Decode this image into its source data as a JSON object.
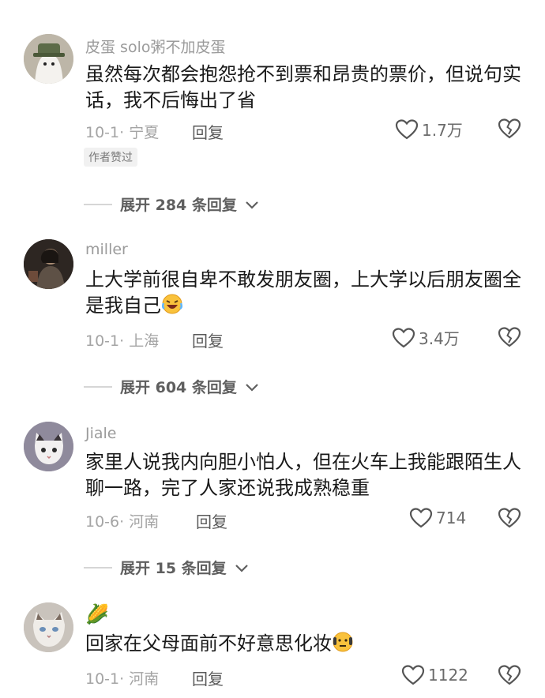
{
  "comments": [
    {
      "username": "皮蛋 solo粥不加皮蛋",
      "text": "虽然每次都会抱怨抢不到票和昂贵的票价，但说句实话，我不后悔出了省",
      "meta": "10-1· 宁夏",
      "reply_label": "回复",
      "likes": "1.7万",
      "badge": "作者赞过",
      "expand_label": "展开 284 条回复",
      "avatar_icon": "ghost-avatar"
    },
    {
      "username": "miller",
      "text": "上大学前很自卑不敢发朋友圈，上大学以后朋友圈全是我自己",
      "meta": "10-1· 上海",
      "reply_label": "回复",
      "likes": "3.4万",
      "expand_label": "展开 604 条回复",
      "avatar_icon": "person-avatar",
      "emoji_icon": "rofl-emoji"
    },
    {
      "username": "Jiale",
      "text": "家里人说我内向胆小怕人，但在火车上我能跟陌生人聊一路，完了人家还说我成熟稳重",
      "meta": "10-6· 河南",
      "reply_label": "回复",
      "likes": "714",
      "expand_label": "展开 15 条回复",
      "avatar_icon": "cat-avatar"
    },
    {
      "username": "🌽",
      "text": "回家在父母面前不好意思化妆",
      "meta": "10-1· 河南",
      "reply_label": "回复",
      "likes": "1122",
      "avatar_icon": "cat-avatar",
      "emoji_icon": "awkward-face-emoji"
    }
  ],
  "colors": {
    "text": "#1a1a1a",
    "muted": "#a4a4a4",
    "badge_bg": "#f1f1f1"
  }
}
